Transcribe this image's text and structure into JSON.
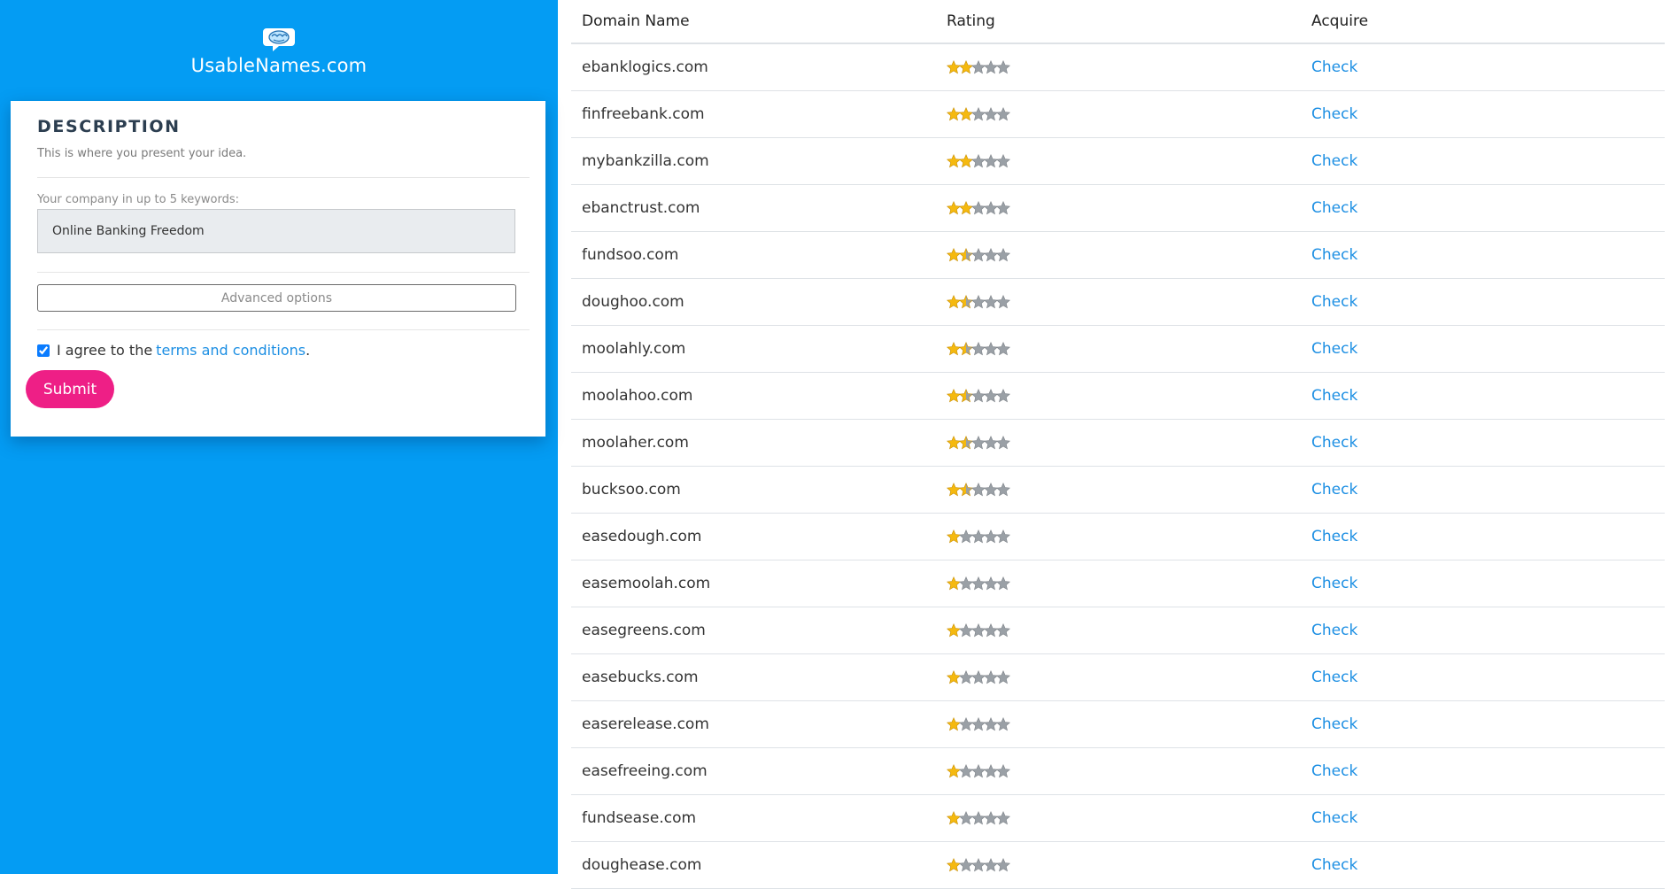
{
  "brand": {
    "name": "UsableNames.com",
    "logo_icon": "brain-chat-icon"
  },
  "description_card": {
    "title": "DESCRIPTION",
    "subtitle": "This is where you present your idea.",
    "keywords_label": "Your company in up to 5 keywords:",
    "keywords_value": "Online Banking Freedom",
    "advanced_label": "Advanced options",
    "agree_prefix": "I agree to the",
    "terms_link": "terms and conditions",
    "agree_suffix": ".",
    "agree_checked": true,
    "submit_label": "Submit"
  },
  "table": {
    "headers": [
      "Domain Name",
      "Rating",
      "Acquire"
    ],
    "max_rating": 5,
    "rows": [
      {
        "domain": "ebanklogics.com",
        "rating": 2,
        "action": "Check"
      },
      {
        "domain": "finfreebank.com",
        "rating": 2,
        "action": "Check"
      },
      {
        "domain": "mybankzilla.com",
        "rating": 2,
        "action": "Check"
      },
      {
        "domain": "ebanctrust.com",
        "rating": 2,
        "action": "Check"
      },
      {
        "domain": "fundsoo.com",
        "rating": 1.5,
        "action": "Check"
      },
      {
        "domain": "doughoo.com",
        "rating": 1.5,
        "action": "Check"
      },
      {
        "domain": "moolahly.com",
        "rating": 1.5,
        "action": "Check"
      },
      {
        "domain": "moolahoo.com",
        "rating": 1.5,
        "action": "Check"
      },
      {
        "domain": "moolaher.com",
        "rating": 1.5,
        "action": "Check"
      },
      {
        "domain": "bucksoo.com",
        "rating": 1.5,
        "action": "Check"
      },
      {
        "domain": "easedough.com",
        "rating": 1,
        "action": "Check"
      },
      {
        "domain": "easemoolah.com",
        "rating": 1,
        "action": "Check"
      },
      {
        "domain": "easegreens.com",
        "rating": 1,
        "action": "Check"
      },
      {
        "domain": "easebucks.com",
        "rating": 1,
        "action": "Check"
      },
      {
        "domain": "easerelease.com",
        "rating": 1,
        "action": "Check"
      },
      {
        "domain": "easefreeing.com",
        "rating": 1,
        "action": "Check"
      },
      {
        "domain": "fundsease.com",
        "rating": 1,
        "action": "Check"
      },
      {
        "domain": "doughease.com",
        "rating": 1,
        "action": "Check"
      }
    ]
  },
  "colors": {
    "sidebar_bg": "#049cf3",
    "star_filled": "#f5b90f",
    "star_empty": "#9aa0a6",
    "link": "#1d8fe3",
    "submit_bg": "#ee1f86"
  }
}
